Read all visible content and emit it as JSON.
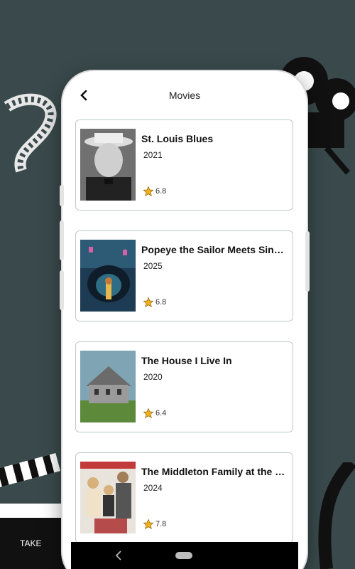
{
  "header": {
    "title": "Movies",
    "back_icon": "back-arrow-icon"
  },
  "movies": [
    {
      "title": "St. Louis Blues",
      "year": "2021",
      "rating": "6.8"
    },
    {
      "title": "Popeye the Sailor Meets Sindbad the Sailor",
      "year": "2025",
      "rating": "6.8"
    },
    {
      "title": "The House I Live In",
      "year": "2020",
      "rating": "6.4"
    },
    {
      "title": "The Middleton Family at the New York World's Fair",
      "year": "2024",
      "rating": "7.8"
    }
  ],
  "colors": {
    "background": "#3a4a4c",
    "star": "#f2b01e",
    "card_border": "#bfc9c9"
  },
  "icons": {
    "rating": "star-icon",
    "nav_back": "nav-back-icon",
    "nav_home": "nav-home-pill"
  }
}
